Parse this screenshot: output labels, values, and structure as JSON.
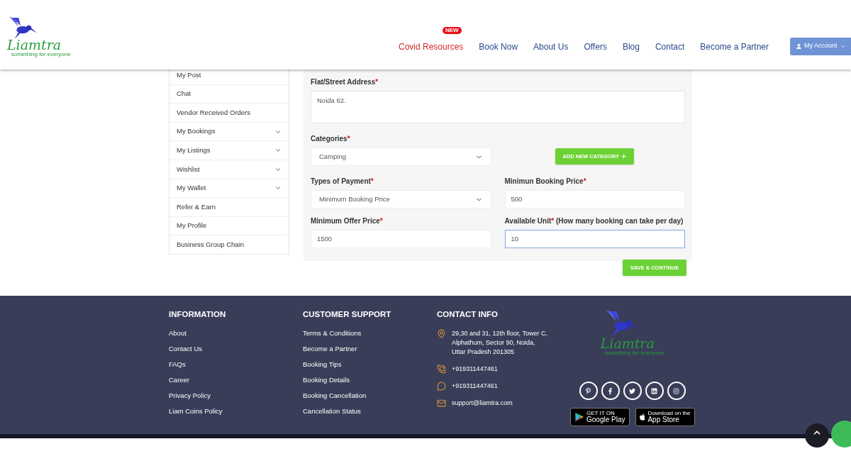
{
  "header": {
    "logo": {
      "name": "Liamtra",
      "tagline": "something for everyone"
    },
    "nav": [
      {
        "label": "Covid Resources",
        "kind": "highlight",
        "badge": "NEW"
      },
      {
        "label": "Book Now",
        "kind": "normal"
      },
      {
        "label": "About Us",
        "kind": "normal"
      },
      {
        "label": "Offers",
        "kind": "normal"
      },
      {
        "label": "Blog",
        "kind": "normal"
      },
      {
        "label": "Contact",
        "kind": "normal"
      },
      {
        "label": "Become a Partner",
        "kind": "normal"
      }
    ],
    "account_button": "My Account"
  },
  "sidebar": {
    "items": [
      {
        "label": "My Post",
        "expandable": false
      },
      {
        "label": "Chat",
        "expandable": false
      },
      {
        "label": "Vendor Received Orders",
        "expandable": false
      },
      {
        "label": "My Bookings",
        "expandable": true
      },
      {
        "label": "My Listings",
        "expandable": true
      },
      {
        "label": "Wishlist",
        "expandable": true
      },
      {
        "label": "My Wallet",
        "expandable": true
      },
      {
        "label": "Refer & Earn",
        "expandable": false
      },
      {
        "label": "My Profile",
        "expandable": false
      },
      {
        "label": "Business Group Chain",
        "expandable": false
      }
    ]
  },
  "form": {
    "address": {
      "label": "Flat/Street Address",
      "mark": "*",
      "value": "Noida 62."
    },
    "category": {
      "label": "Categories",
      "mark": "*",
      "value": "Camping"
    },
    "add_category_button": "ADD NEW CATEGORY",
    "payment_type": {
      "label": "Types of Payment",
      "mark": "*",
      "value": "Minimum Booking Price"
    },
    "min_booking_price": {
      "label": "Minimun Booking Price",
      "mark": "*",
      "value": "500"
    },
    "min_offer_price": {
      "label": "Minimum Offer Price",
      "mark": "*",
      "value": "1500"
    },
    "available_unit": {
      "label": "Available Unit",
      "mark": "*",
      "note": "(How many booking can take per day)",
      "value": "10",
      "focused": true
    },
    "save_button": "SAVE & CONTINUE"
  },
  "footer": {
    "information": {
      "title": "INFORMATION",
      "links": [
        "About",
        "Contact Us",
        "FAQs",
        "Career",
        "Privacy Policy",
        "Liam Coins Policy"
      ]
    },
    "support": {
      "title": "CUSTOMER SUPPORT",
      "links": [
        "Terms & Conditions",
        "Become a Partner",
        "Booking Tips",
        "Booking Details",
        "Booking Cancellation",
        "Cancellation Status"
      ]
    },
    "contact": {
      "title": "CONTACT INFO",
      "items": [
        {
          "kind": "address",
          "lines": [
            "29,30 and 31, 12th floor, Tower C,",
            "Alphathum, Sector 90, Noida,",
            "Uttar Pradesh 201305"
          ]
        },
        {
          "kind": "phone",
          "lines": [
            "+919311447461"
          ]
        },
        {
          "kind": "whatsapp",
          "lines": [
            "+919311447461"
          ]
        },
        {
          "kind": "email",
          "lines": [
            "support@liamtra.com"
          ]
        }
      ]
    },
    "logo": {
      "name": "Liamtra",
      "tagline": "something for everyone"
    },
    "socials": [
      {
        "kind": "pinterest"
      },
      {
        "kind": "facebook"
      },
      {
        "kind": "twitter"
      },
      {
        "kind": "linkedin"
      },
      {
        "kind": "instagram"
      }
    ],
    "stores": [
      {
        "kind": "google",
        "small": "GET IT ON",
        "big": "Google Play"
      },
      {
        "kind": "apple",
        "small": "Download on the",
        "big": "App Store"
      }
    ]
  }
}
